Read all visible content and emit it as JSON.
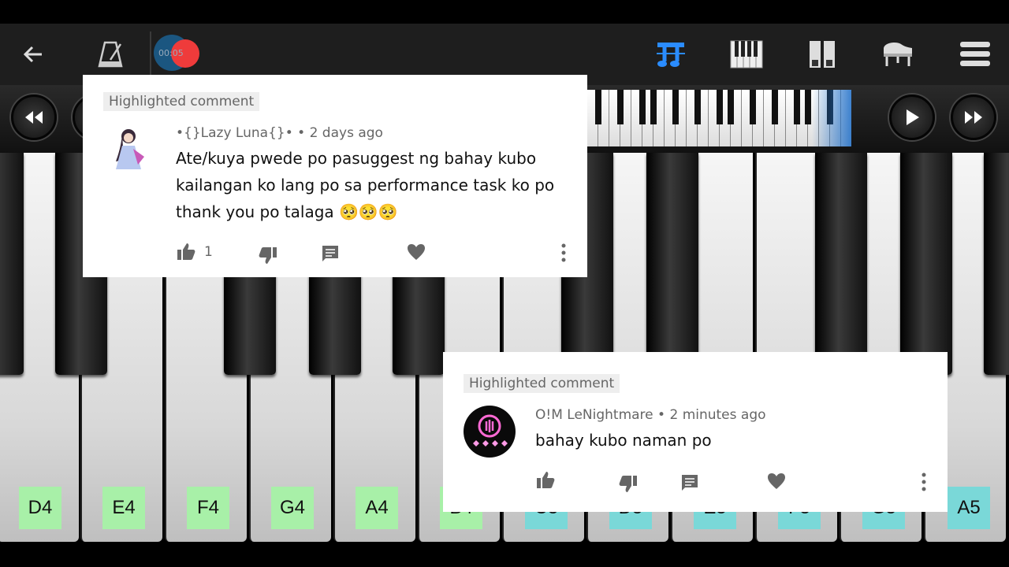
{
  "toolbar": {
    "timer": "00:05",
    "icons": [
      "back-arrow-icon",
      "metronome-icon",
      "record-icon",
      "music-score-icon",
      "keyboard-icon",
      "dual-keyboard-icon",
      "grand-piano-icon",
      "menu-icon"
    ]
  },
  "navigation": {
    "icons": [
      "rewind-icon",
      "play-icon",
      "fast-forward-icon"
    ]
  },
  "piano": {
    "labels": [
      "D4",
      "E4",
      "F4",
      "G4",
      "A4",
      "B4",
      "C5",
      "D5",
      "E5",
      "F5",
      "G5",
      "A5"
    ],
    "label_colors": {
      "octave4": "#a8f0a8",
      "octave5": "#7ad8d8"
    }
  },
  "comment1": {
    "badge": "Highlighted comment",
    "author": "•{}Lazy Luna{}•",
    "time": "2 days ago",
    "lines": [
      "Ate/kuya pwede po pasuggest ng bahay kubo",
      "kailangan ko lang po sa performance task ko po",
      "thank you po talaga 🥺🥺🥺"
    ],
    "likes": "1"
  },
  "comment2": {
    "badge": "Highlighted comment",
    "author": "O!M LeNightmare",
    "time": "2 minutes ago",
    "text": "bahay kubo naman po"
  },
  "separator": "•"
}
